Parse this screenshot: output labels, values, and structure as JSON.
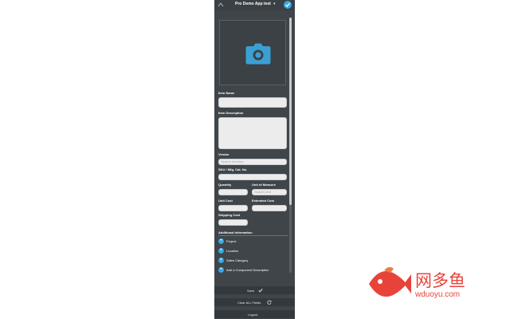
{
  "app": {
    "title": "Pro Demo App test",
    "caret": "▾"
  },
  "form": {
    "item_name_label": "Item Name",
    "item_description_label": "Item Description",
    "vendor_label": "Vendor",
    "vendor_placeholder": "Search Vendors",
    "sku_label": "SKU / Mfg. Cat. No.",
    "quantity_label": "Quantity",
    "uom_label": "Unit of Measure",
    "uom_placeholder": "Search Unit",
    "unit_cost_label": "Unit Cost",
    "extended_cost_label": "Extended Cost",
    "shipping_cost_label": "Shipping Cost",
    "additional_info_label": "Additional Information",
    "add_items": [
      {
        "label": "Project"
      },
      {
        "label": "Location"
      },
      {
        "label": "Sales Category"
      },
      {
        "label": "Add a Component Description"
      }
    ]
  },
  "actions": {
    "save_label": "Save",
    "clear_label": "Clear ALL Fields",
    "logout_label": "Logout"
  },
  "watermark": {
    "brand_cn": "网多鱼",
    "brand_url": "wduoyu.com"
  },
  "colors": {
    "accent": "#38a7e0",
    "panel": "#3f4549",
    "watermark": "#e8433a"
  }
}
